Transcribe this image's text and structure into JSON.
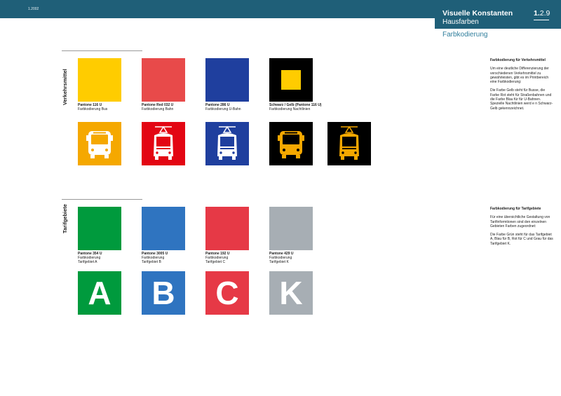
{
  "header": {
    "date": "1.2002",
    "title": "Visuelle Konstanten",
    "subtitle": "Hausfarben",
    "page_number_prefix": "1.",
    "page_number_rest": "2.9",
    "section": "Farbkodierung"
  },
  "transport": {
    "vertical_label": "Verkehrsmittel",
    "swatches": [
      {
        "color": "#ffcc00",
        "code": "Pantone 116 U",
        "desc": "Farbkodierung Bus"
      },
      {
        "color": "#e84a4a",
        "code": "Pantone Red 032 U",
        "desc": "Farbkodierung Bahn"
      },
      {
        "color": "#1f3f9e",
        "code": "Pantone 286 U",
        "desc": "Farbkodierung U-Bahn"
      },
      {
        "color": "#000000",
        "inner": "#ffcc00",
        "code": "Schwarz / Gelb (Pantone 116 U)",
        "desc": "Farbkodierung Nachtlinien"
      }
    ],
    "icons": [
      {
        "name": "bus-icon",
        "bg": "#f5a800",
        "fg": "#ffffff"
      },
      {
        "name": "tram-icon",
        "bg": "#e30613",
        "fg": "#ffffff"
      },
      {
        "name": "subway-icon",
        "bg": "#1f3f9e",
        "fg": "#ffffff"
      },
      {
        "name": "night-bus-icon",
        "bg": "#000000",
        "fg": "#f5a800"
      },
      {
        "name": "night-tram-icon",
        "bg": "#000000",
        "fg": "#f5a800"
      }
    ],
    "side": {
      "title": "Farbkodierung für Verkehrsmittel",
      "p1": "Um eine deutliche Differenzierung der verschiedenen Verkehrsmittel zu gewährleisten, gibt es im Printbereich eine Farbkodierung:",
      "p2": "Die Farbe Gelb steht für Busse, die Farbe Rot steht für Straßenbahnen und die Farbe Blau für für U-Bahnen. Spezielle Nachtlinien werd e n Schwarz-Gelb gekennzeichnet."
    }
  },
  "tariff": {
    "vertical_label": "Tarifgebiete",
    "swatches": [
      {
        "color": "#009a3d",
        "code": "Pantone 354 U",
        "desc1": "Farbkodierung",
        "desc2": "Tarifgebiet A"
      },
      {
        "color": "#2f74c0",
        "code": "Pantone 3005 U",
        "desc1": "Farbkodierung",
        "desc2": "Tarifgebiet  B"
      },
      {
        "color": "#e63946",
        "code": "Pantone 192 U",
        "desc1": "Farbkodierung",
        "desc2": "Tarifgebiet C"
      },
      {
        "color": "#a7aeb4",
        "code": "Pantone 429 U",
        "desc1": "Farbkodierung",
        "desc2": "Tarifgebiet K"
      }
    ],
    "letters": [
      {
        "letter": "A",
        "bg": "#009a3d"
      },
      {
        "letter": "B",
        "bg": "#2f74c0"
      },
      {
        "letter": "C",
        "bg": "#e63946"
      },
      {
        "letter": "K",
        "bg": "#a7aeb4"
      }
    ],
    "side": {
      "title": "Farbkodierung für Tarifgebiete",
      "p1": "Für eine übersichtliche Gestaltung von Tarifinformtionen sind den einzelnen Gebieten Farben zugeordnet:",
      "p2": "Die Farbe Grün steht für das Tarifgebiet A, Blau für B, Rot für C und Grau für das Tarifgebiet K."
    }
  }
}
